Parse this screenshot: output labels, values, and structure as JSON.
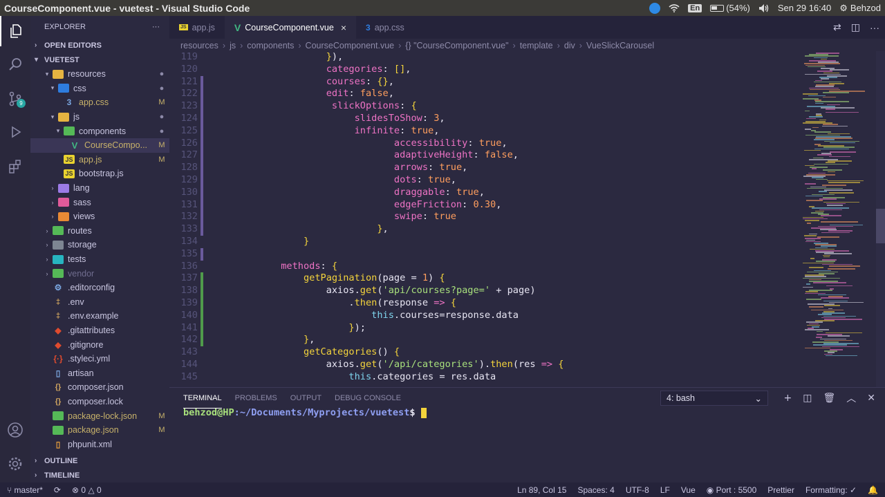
{
  "window": {
    "title": "CourseComponent.vue - vuetest - Visual Studio Code"
  },
  "tray": {
    "battery": "(54%)",
    "language": "En",
    "datetime": "Sen 29 16:40",
    "user": "Behzod"
  },
  "activity_bar": {
    "scm_badge": "9"
  },
  "explorer": {
    "header": "EXPLORER",
    "more": "···",
    "open_editors": "OPEN EDITORS",
    "project": "VUETEST",
    "items": [
      {
        "label": "resources",
        "depth": 1,
        "twisty": "▾",
        "icon": "folder-open-icon",
        "status": "●"
      },
      {
        "label": "css",
        "depth": 2,
        "twisty": "▾",
        "icon": "css-folder-icon",
        "status": "●"
      },
      {
        "label": "app.css",
        "depth": 3,
        "twisty": "",
        "icon": "css-file-icon",
        "status": "M"
      },
      {
        "label": "js",
        "depth": 2,
        "twisty": "▾",
        "icon": "js-folder-icon",
        "status": "●"
      },
      {
        "label": "components",
        "depth": 3,
        "twisty": "▾",
        "icon": "components-folder-icon",
        "status": "●"
      },
      {
        "label": "CourseCompo...",
        "depth": 4,
        "twisty": "",
        "icon": "vue-file-icon",
        "status": "M"
      },
      {
        "label": "app.js",
        "depth": 3,
        "twisty": "",
        "icon": "js-file-icon",
        "status": "M"
      },
      {
        "label": "bootstrap.js",
        "depth": 3,
        "twisty": "",
        "icon": "js-file-icon",
        "status": ""
      },
      {
        "label": "lang",
        "depth": 2,
        "twisty": "›",
        "icon": "lang-folder-icon",
        "status": ""
      },
      {
        "label": "sass",
        "depth": 2,
        "twisty": "›",
        "icon": "sass-folder-icon",
        "status": ""
      },
      {
        "label": "views",
        "depth": 2,
        "twisty": "›",
        "icon": "views-folder-icon",
        "status": ""
      },
      {
        "label": "routes",
        "depth": 1,
        "twisty": "›",
        "icon": "routes-folder-icon",
        "status": ""
      },
      {
        "label": "storage",
        "depth": 1,
        "twisty": "›",
        "icon": "folder-icon",
        "status": ""
      },
      {
        "label": "tests",
        "depth": 1,
        "twisty": "›",
        "icon": "tests-folder-icon",
        "status": ""
      },
      {
        "label": "vendor",
        "depth": 1,
        "twisty": "›",
        "icon": "vendor-folder-icon",
        "status": ""
      },
      {
        "label": ".editorconfig",
        "depth": 1,
        "twisty": "",
        "icon": "gear-file-icon",
        "status": ""
      },
      {
        "label": ".env",
        "depth": 1,
        "twisty": "",
        "icon": "env-file-icon",
        "status": ""
      },
      {
        "label": ".env.example",
        "depth": 1,
        "twisty": "",
        "icon": "env-file-icon",
        "status": ""
      },
      {
        "label": ".gitattributes",
        "depth": 1,
        "twisty": "",
        "icon": "git-file-icon",
        "status": ""
      },
      {
        "label": ".gitignore",
        "depth": 1,
        "twisty": "",
        "icon": "git-file-icon",
        "status": ""
      },
      {
        "label": ".styleci.yml",
        "depth": 1,
        "twisty": "",
        "icon": "yaml-file-icon",
        "status": ""
      },
      {
        "label": "artisan",
        "depth": 1,
        "twisty": "",
        "icon": "file-icon",
        "status": ""
      },
      {
        "label": "composer.json",
        "depth": 1,
        "twisty": "",
        "icon": "json-file-icon",
        "status": ""
      },
      {
        "label": "composer.lock",
        "depth": 1,
        "twisty": "",
        "icon": "json-file-icon",
        "status": ""
      },
      {
        "label": "package-lock.json",
        "depth": 1,
        "twisty": "",
        "icon": "npm-file-icon",
        "status": "M"
      },
      {
        "label": "package.json",
        "depth": 1,
        "twisty": "",
        "icon": "npm-file-icon",
        "status": "M"
      },
      {
        "label": "phpunit.xml",
        "depth": 1,
        "twisty": "",
        "icon": "xml-file-icon",
        "status": ""
      }
    ],
    "outline": "OUTLINE",
    "timeline": "TIMELINE"
  },
  "tabs": [
    {
      "label": "app.js",
      "icon": "js-file-icon",
      "active": false
    },
    {
      "label": "CourseComponent.vue",
      "icon": "vue-file-icon",
      "active": true
    },
    {
      "label": "app.css",
      "icon": "css-file-icon",
      "active": false
    }
  ],
  "breadcrumb": [
    "resources",
    "js",
    "components",
    "CourseComponent.vue",
    "{} \"CourseComponent.vue\"",
    "template",
    "div",
    "VueSlickCarousel"
  ],
  "editor": {
    "lines": [
      {
        "n": "119",
        "g": "",
        "t": [
          [
            "",
            "                    "
          ],
          [
            "tok-punc",
            "}"
          ],
          [
            "",
            "),"
          ]
        ]
      },
      {
        "n": "120",
        "g": "",
        "t": [
          [
            "",
            "                    "
          ],
          [
            "tok-prop",
            "categories"
          ],
          [
            "",
            ": "
          ],
          [
            "tok-punc",
            "[]"
          ],
          [
            "",
            ","
          ]
        ]
      },
      {
        "n": "121",
        "g": "mod",
        "t": [
          [
            "",
            "                    "
          ],
          [
            "tok-prop",
            "courses"
          ],
          [
            "",
            ": "
          ],
          [
            "tok-punc",
            "{}"
          ],
          [
            "",
            ","
          ]
        ]
      },
      {
        "n": "122",
        "g": "mod",
        "t": [
          [
            "",
            "                    "
          ],
          [
            "tok-prop",
            "edit"
          ],
          [
            "",
            ": "
          ],
          [
            "tok-bool",
            "false"
          ],
          [
            "",
            ","
          ]
        ]
      },
      {
        "n": "123",
        "g": "mod",
        "t": [
          [
            "",
            "                     "
          ],
          [
            "tok-prop",
            "slickOptions"
          ],
          [
            "",
            ": "
          ],
          [
            "tok-punc",
            "{"
          ]
        ]
      },
      {
        "n": "124",
        "g": "mod",
        "t": [
          [
            "",
            "                         "
          ],
          [
            "tok-prop",
            "slidesToShow"
          ],
          [
            "",
            ": "
          ],
          [
            "tok-num",
            "3"
          ],
          [
            "",
            ","
          ]
        ]
      },
      {
        "n": "125",
        "g": "mod",
        "t": [
          [
            "",
            "                         "
          ],
          [
            "tok-prop",
            "infinite"
          ],
          [
            "",
            ": "
          ],
          [
            "tok-bool",
            "true"
          ],
          [
            "",
            ","
          ]
        ]
      },
      {
        "n": "126",
        "g": "mod",
        "t": [
          [
            "",
            "                                "
          ],
          [
            "tok-prop",
            "accessibility"
          ],
          [
            "",
            ": "
          ],
          [
            "tok-bool",
            "true"
          ],
          [
            "",
            ","
          ]
        ]
      },
      {
        "n": "127",
        "g": "mod",
        "t": [
          [
            "",
            "                                "
          ],
          [
            "tok-prop",
            "adaptiveHeight"
          ],
          [
            "",
            ": "
          ],
          [
            "tok-bool",
            "false"
          ],
          [
            "",
            ","
          ]
        ]
      },
      {
        "n": "128",
        "g": "mod",
        "t": [
          [
            "",
            "                                "
          ],
          [
            "tok-prop",
            "arrows"
          ],
          [
            "",
            ": "
          ],
          [
            "tok-bool",
            "true"
          ],
          [
            "",
            ","
          ]
        ]
      },
      {
        "n": "129",
        "g": "mod",
        "t": [
          [
            "",
            "                                "
          ],
          [
            "tok-prop",
            "dots"
          ],
          [
            "",
            ": "
          ],
          [
            "tok-bool",
            "true"
          ],
          [
            "",
            ","
          ]
        ]
      },
      {
        "n": "130",
        "g": "mod",
        "t": [
          [
            "",
            "                                "
          ],
          [
            "tok-prop",
            "draggable"
          ],
          [
            "",
            ": "
          ],
          [
            "tok-bool",
            "true"
          ],
          [
            "",
            ","
          ]
        ]
      },
      {
        "n": "131",
        "g": "mod",
        "t": [
          [
            "",
            "                                "
          ],
          [
            "tok-prop",
            "edgeFriction"
          ],
          [
            "",
            ": "
          ],
          [
            "tok-num",
            "0.30"
          ],
          [
            "",
            ","
          ]
        ]
      },
      {
        "n": "132",
        "g": "mod",
        "t": [
          [
            "",
            "                                "
          ],
          [
            "tok-prop",
            "swipe"
          ],
          [
            "",
            ": "
          ],
          [
            "tok-bool",
            "true"
          ]
        ]
      },
      {
        "n": "133",
        "g": "mod",
        "t": [
          [
            "",
            "                             "
          ],
          [
            "tok-punc",
            "}"
          ],
          [
            "",
            ","
          ]
        ]
      },
      {
        "n": "134",
        "g": "",
        "t": [
          [
            "",
            "                "
          ],
          [
            "tok-punc",
            "}"
          ]
        ]
      },
      {
        "n": "135",
        "g": "mod",
        "t": [
          [
            "",
            ""
          ]
        ]
      },
      {
        "n": "136",
        "g": "",
        "t": [
          [
            "",
            "            "
          ],
          [
            "tok-prop",
            "methods"
          ],
          [
            "",
            ": "
          ],
          [
            "tok-punc",
            "{"
          ]
        ]
      },
      {
        "n": "137",
        "g": "add",
        "t": [
          [
            "",
            "                "
          ],
          [
            "tok-fn",
            "getPagination"
          ],
          [
            "",
            "(page = "
          ],
          [
            "tok-num",
            "1"
          ],
          [
            "",
            ") "
          ],
          [
            "tok-punc",
            "{"
          ]
        ]
      },
      {
        "n": "138",
        "g": "add",
        "t": [
          [
            "",
            "                    axios."
          ],
          [
            "tok-fn",
            "get"
          ],
          [
            "",
            "("
          ],
          [
            "tok-str",
            "'api/courses?page='"
          ],
          [
            "",
            " + page)"
          ]
        ]
      },
      {
        "n": "139",
        "g": "add",
        "t": [
          [
            "",
            "                        ."
          ],
          [
            "tok-fn",
            "then"
          ],
          [
            "",
            "(response "
          ],
          [
            "tok-kw",
            "=>"
          ],
          [
            "",
            " "
          ],
          [
            "tok-punc",
            "{"
          ]
        ]
      },
      {
        "n": "140",
        "g": "add",
        "t": [
          [
            "",
            "                            "
          ],
          [
            "tok-this",
            "this"
          ],
          [
            "",
            ".courses=response.data"
          ]
        ]
      },
      {
        "n": "141",
        "g": "add",
        "t": [
          [
            "",
            "                        "
          ],
          [
            "tok-punc",
            "}"
          ],
          [
            "",
            ");"
          ]
        ]
      },
      {
        "n": "142",
        "g": "add",
        "t": [
          [
            "",
            "                "
          ],
          [
            "tok-punc",
            "}"
          ],
          [
            "",
            ","
          ]
        ]
      },
      {
        "n": "143",
        "g": "",
        "t": [
          [
            "",
            "                "
          ],
          [
            "tok-fn",
            "getCategories"
          ],
          [
            "",
            "() "
          ],
          [
            "tok-punc",
            "{"
          ]
        ]
      },
      {
        "n": "144",
        "g": "",
        "t": [
          [
            "",
            "                    axios."
          ],
          [
            "tok-fn",
            "get"
          ],
          [
            "",
            "("
          ],
          [
            "tok-str",
            "'/api/categories'"
          ],
          [
            "",
            ")."
          ],
          [
            "tok-fn",
            "then"
          ],
          [
            "",
            "(res "
          ],
          [
            "tok-kw",
            "=>"
          ],
          [
            "",
            " "
          ],
          [
            "tok-punc",
            "{"
          ]
        ]
      },
      {
        "n": "145",
        "g": "",
        "t": [
          [
            "",
            "                        "
          ],
          [
            "tok-this",
            "this"
          ],
          [
            "",
            ".categories = res.data"
          ]
        ]
      }
    ]
  },
  "panel": {
    "tabs": [
      "TERMINAL",
      "PROBLEMS",
      "OUTPUT",
      "DEBUG CONSOLE"
    ],
    "active_tab": "TERMINAL",
    "terminal_select": "4: bash",
    "prompt_user": "behzod@HP",
    "prompt_path": ":~/Documents/Myprojects/vuetest",
    "prompt_symbol": "$"
  },
  "status": {
    "branch": "master*",
    "errors": "0",
    "warnings": "0",
    "cursor": "Ln 89, Col 15",
    "spaces": "Spaces: 4",
    "encoding": "UTF-8",
    "eol": "LF",
    "language": "Vue",
    "port": "Port : 5500",
    "prettier": "Prettier",
    "formatting": "Formatting: ✓"
  },
  "colors": {
    "editor_bg": "#2b2940",
    "sidebar_bg": "#2b2940",
    "activity_bg": "#2a283c",
    "tabbar_bg": "#25233a",
    "accent_pink": "#ee73c5",
    "accent_yellow": "#f4d43c",
    "accent_orange": "#ff9e5e",
    "accent_green": "#a8e07c"
  }
}
